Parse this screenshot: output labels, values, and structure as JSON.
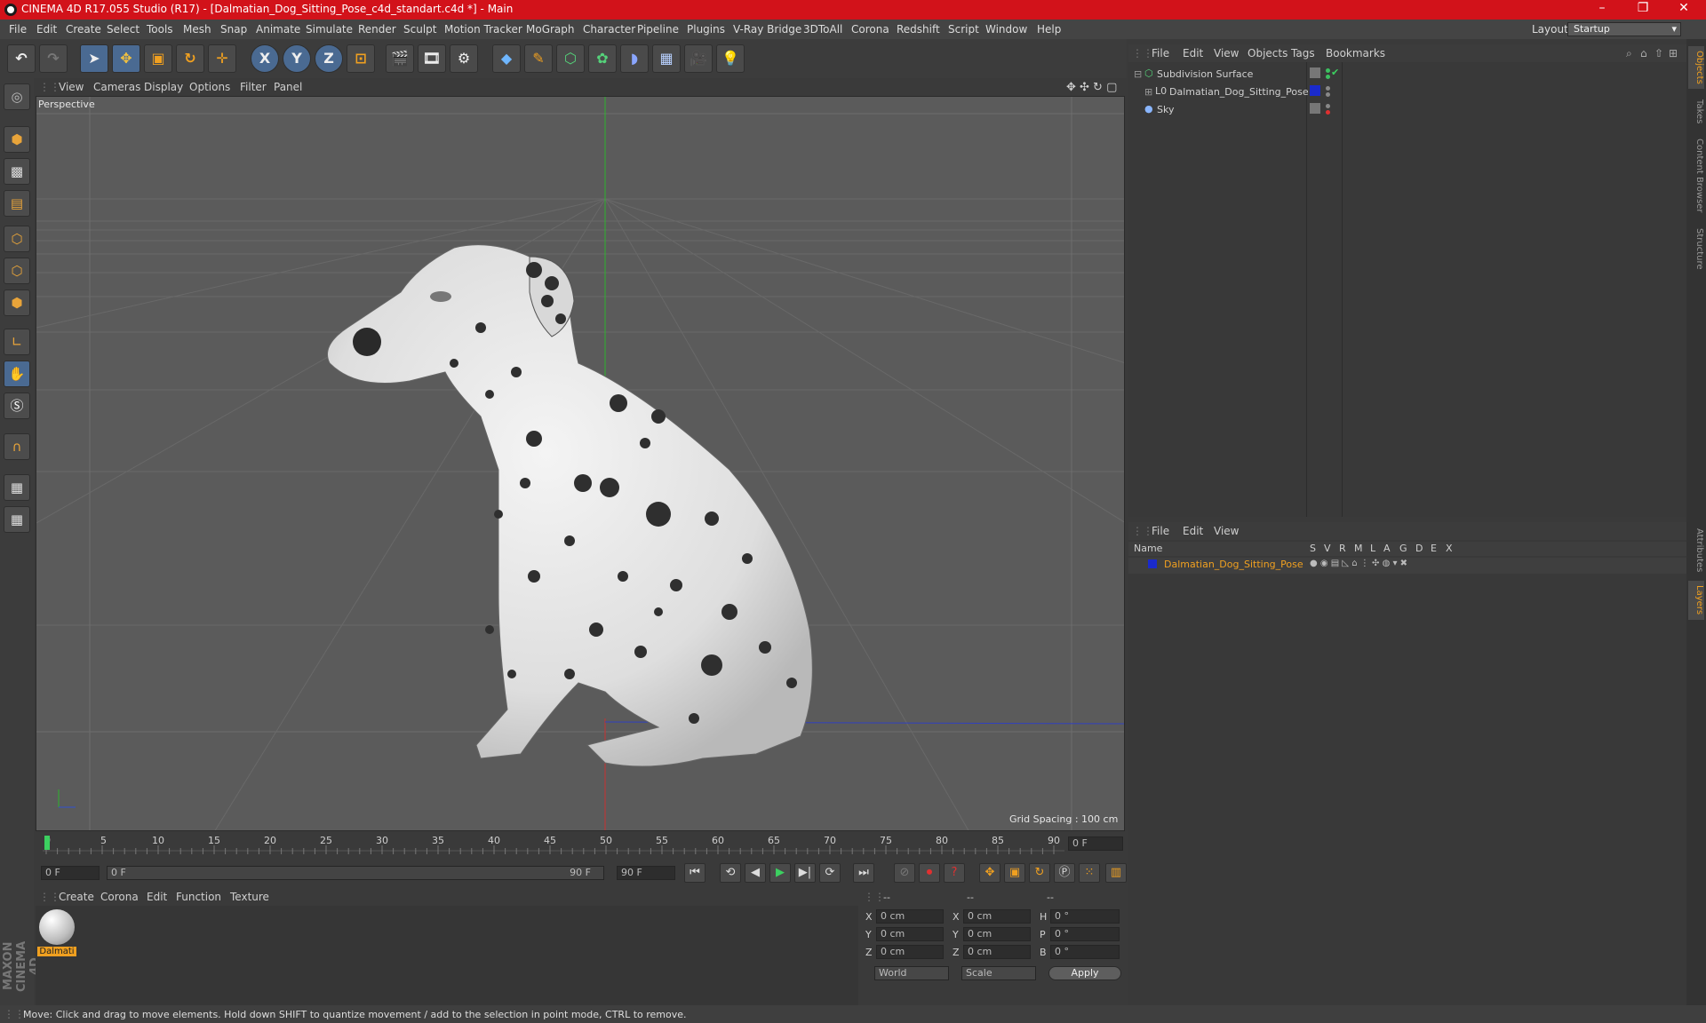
{
  "window": {
    "title": "CINEMA 4D R17.055 Studio (R17) - [Dalmatian_Dog_Sitting_Pose_c4d_standart.c4d *] - Main"
  },
  "menu": [
    "File",
    "Edit",
    "Create",
    "Select",
    "Tools",
    "Mesh",
    "Snap",
    "Animate",
    "Simulate",
    "Render",
    "Sculpt",
    "Motion Tracker",
    "MoGraph",
    "Character",
    "Pipeline",
    "Plugins",
    "V-Ray Bridge",
    "3DToAll",
    "Corona",
    "Redshift",
    "Script",
    "Window",
    "Help"
  ],
  "layout": {
    "label": "Layout:",
    "value": "Startup"
  },
  "toolbar": {
    "axis_x": "X",
    "axis_y": "Y",
    "axis_z": "Z"
  },
  "viewport": {
    "menu": [
      "View",
      "Cameras",
      "Display",
      "Options",
      "Filter",
      "Panel"
    ],
    "label": "Perspective",
    "grid_spacing": "Grid Spacing : 100 cm"
  },
  "timeline": {
    "ticks": [
      "0",
      "5",
      "10",
      "15",
      "20",
      "25",
      "30",
      "35",
      "40",
      "45",
      "50",
      "55",
      "60",
      "65",
      "70",
      "75",
      "80",
      "85",
      "90"
    ],
    "current_frame": "0 F",
    "start_field": "0 F",
    "range_start": "0 F",
    "range_end": "90 F",
    "end_field": "90 F"
  },
  "material_manager": {
    "menu": [
      "Create",
      "Corona",
      "Edit",
      "Function",
      "Texture"
    ],
    "materials": [
      {
        "name": "Dalmati"
      }
    ]
  },
  "coordinates": {
    "headers": [
      "--",
      "--",
      "--"
    ],
    "rows": [
      {
        "a": "X",
        "av": "0 cm",
        "b": "X",
        "bv": "0 cm",
        "c": "H",
        "cv": "0 °"
      },
      {
        "a": "Y",
        "av": "0 cm",
        "b": "Y",
        "bv": "0 cm",
        "c": "P",
        "cv": "0 °"
      },
      {
        "a": "Z",
        "av": "0 cm",
        "b": "Z",
        "bv": "0 cm",
        "c": "B",
        "cv": "0 °"
      }
    ],
    "mode": "World",
    "scale_mode": "Scale",
    "apply": "Apply"
  },
  "object_manager": {
    "menu": [
      "File",
      "Edit",
      "View",
      "Objects",
      "Tags",
      "Bookmarks"
    ],
    "objects": [
      {
        "name": "Subdivision Surface"
      },
      {
        "name": "Dalmatian_Dog_Sitting_Pose"
      },
      {
        "name": "Sky"
      }
    ]
  },
  "layer_manager": {
    "menu": [
      "File",
      "Edit",
      "View"
    ],
    "columns": [
      "Name",
      "S",
      "V",
      "R",
      "M",
      "L",
      "A",
      "G",
      "D",
      "E",
      "X"
    ],
    "layers": [
      {
        "name": "Dalmatian_Dog_Sitting_Pose"
      }
    ]
  },
  "side_tabs": [
    "Objects",
    "Takes",
    "Content Browser",
    "Structure",
    "Attributes",
    "Layers"
  ],
  "brand": "MAXON CINEMA 4D",
  "status": "Move: Click and drag to move elements. Hold down SHIFT to quantize movement / add to the selection in point mode, CTRL to remove."
}
